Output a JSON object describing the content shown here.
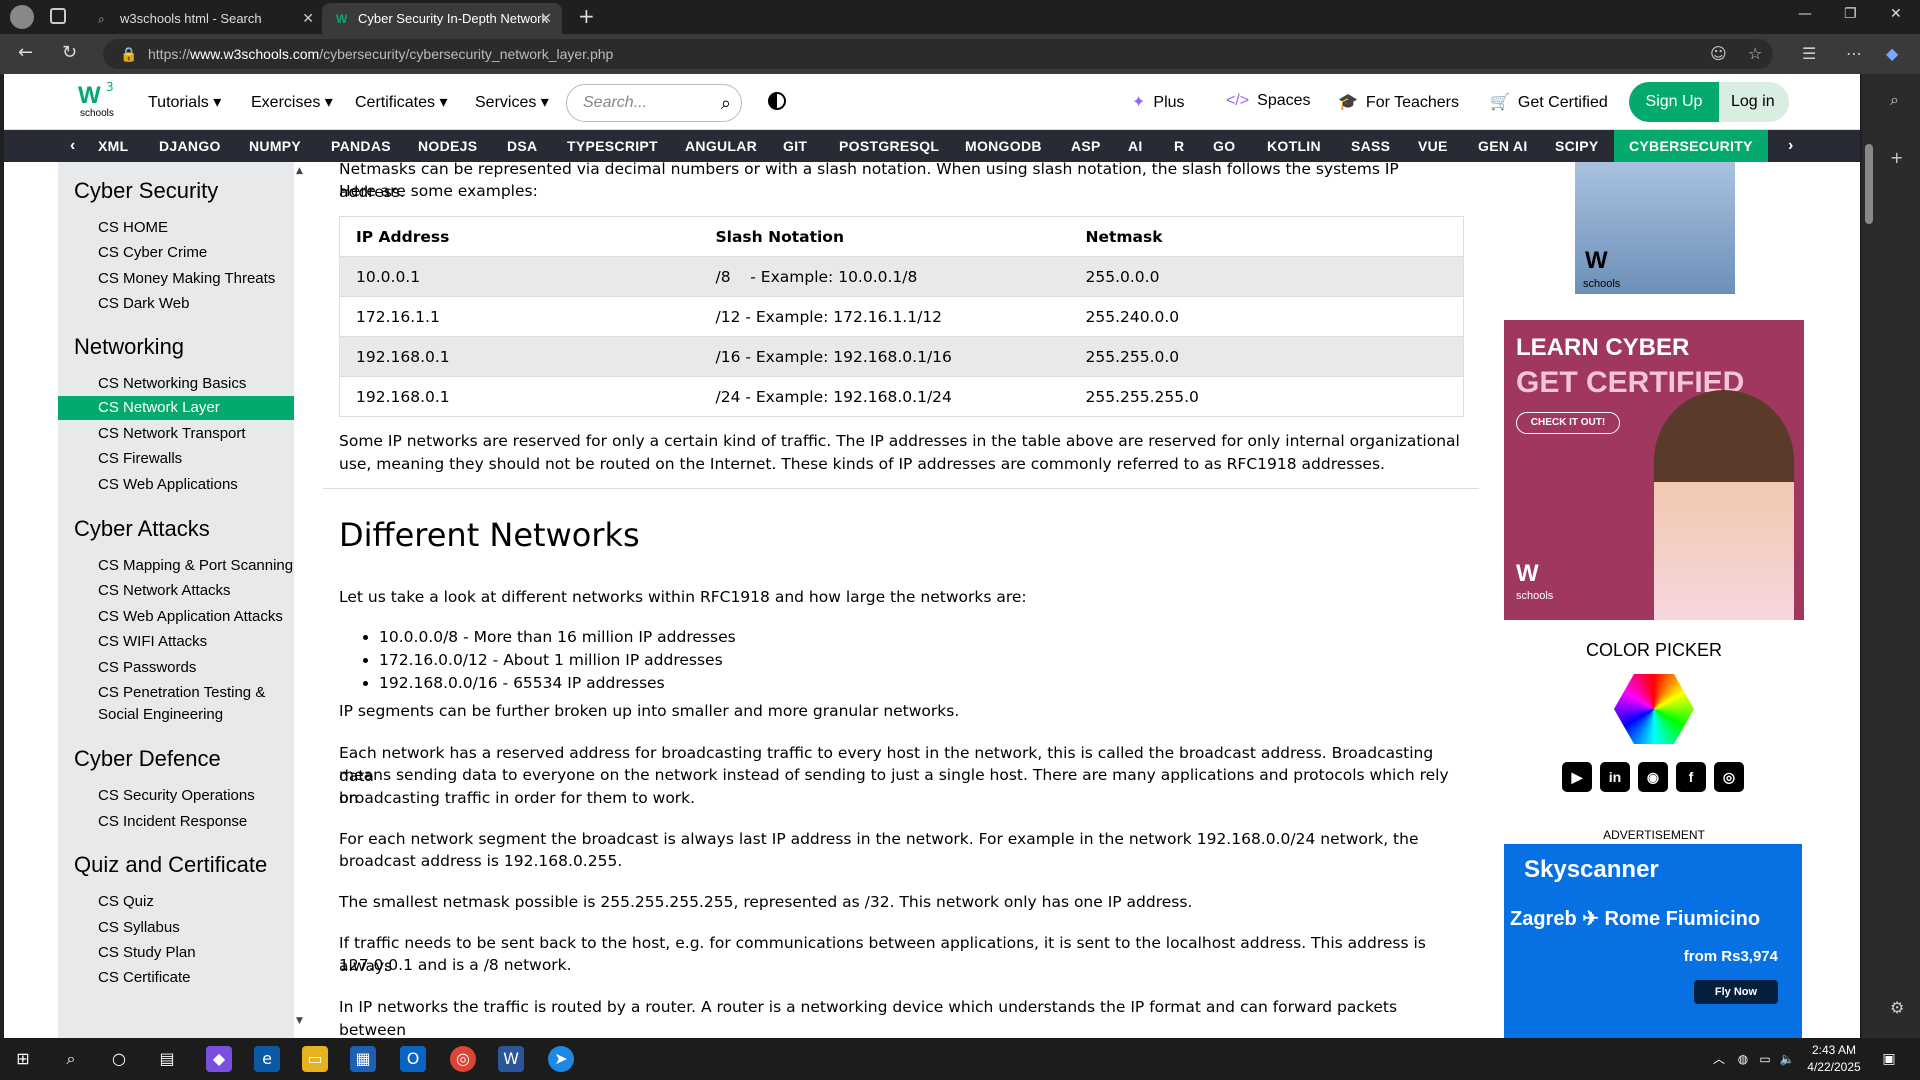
{
  "browser": {
    "tabs": [
      {
        "title": "w3schools html - Search"
      },
      {
        "title": "Cyber Security In-Depth Network"
      }
    ],
    "url_host": "www.w3schools.com",
    "url_path": "/cybersecurity/cybersecurity_network_layer.php",
    "url_scheme": "https://"
  },
  "topnav": {
    "logo_sup": "3",
    "logo_text": "schools",
    "menu": [
      "Tutorials",
      "Exercises",
      "Certificates",
      "Services"
    ],
    "search_placeholder": "Search...",
    "links": [
      "Plus",
      "Spaces",
      "For Teachers",
      "Get Certified"
    ],
    "signup": "Sign Up",
    "login": "Log in"
  },
  "subnav": {
    "items": [
      "XML",
      "DJANGO",
      "NUMPY",
      "PANDAS",
      "NODEJS",
      "DSA",
      "TYPESCRIPT",
      "ANGULAR",
      "GIT",
      "POSTGRESQL",
      "MONGODB",
      "ASP",
      "AI",
      "R",
      "GO",
      "KOTLIN",
      "SASS",
      "VUE",
      "GEN AI",
      "SCIPY",
      "CYBERSECURITY"
    ]
  },
  "sidebar": {
    "sections": [
      {
        "title": "Cyber Security",
        "items": [
          "CS HOME",
          "CS Cyber Crime",
          "CS Money Making Threats",
          "CS Dark Web"
        ]
      },
      {
        "title": "Networking",
        "items": [
          "CS Networking Basics",
          "CS Network Layer",
          "CS Network Transport",
          "CS Firewalls",
          "CS Web Applications"
        ]
      },
      {
        "title": "Cyber Attacks",
        "items": [
          "CS Mapping & Port Scanning",
          "CS Network Attacks",
          "CS Web Application Attacks",
          "CS WIFI Attacks",
          "CS Passwords",
          "CS Penetration Testing &",
          "Social Engineering"
        ]
      },
      {
        "title": "Cyber Defence",
        "items": [
          "CS Security Operations",
          "CS Incident Response"
        ]
      },
      {
        "title": "Quiz and Certificate",
        "items": [
          "CS Quiz",
          "CS Syllabus",
          "CS Study Plan",
          "CS Certificate"
        ]
      }
    ],
    "active": "CS Network Layer"
  },
  "main": {
    "intro_line1": "Netmasks can be represented via decimal numbers or with a slash notation.  When using slash notation, the slash follows the systems IP address.",
    "intro_line2": "Here are some examples:",
    "table": {
      "headers": [
        "IP Address",
        "Slash Notation",
        "Netmask"
      ],
      "rows": [
        [
          "10.0.0.1",
          "/8    - Example: 10.0.0.1/8",
          "255.0.0.0"
        ],
        [
          "172.16.1.1",
          "/12 - Example: 172.16.1.1/12",
          "255.240.0.0"
        ],
        [
          "192.168.0.1",
          "/16 - Example: 192.168.0.1/16",
          "255.255.0.0"
        ],
        [
          "192.168.0.1",
          "/24 - Example: 192.168.0.1/24",
          "255.255.255.0"
        ]
      ]
    },
    "p_reserved_1": "Some IP networks are reserved for only a certain kind of traffic. The IP addresses in the table above are reserved for only internal organizational",
    "p_reserved_2": "use, meaning they should not be routed on the Internet. These kinds of IP addresses are commonly referred to as RFC1918 addresses.",
    "h2": "Different Networks",
    "p_look": "Let us take a look at different networks within RFC1918 and how large the networks are:",
    "list": [
      "10.0.0.0/8 - More than 16 million IP addresses",
      "172.16.0.0/12 - About 1 million IP addresses",
      "192.168.0.0/16 - 65534 IP addresses"
    ],
    "p_segments": "IP segments can be further broken up into smaller and more granular networks.",
    "p_broadcast_1": "Each network has a reserved address for broadcasting traffic to every host in the network, this is called the broadcast address. Broadcasting data",
    "p_broadcast_2": "means sending data to everyone on the network instead of sending to just a single host. There are many applications and protocols which rely on",
    "p_broadcast_3": "broadcasting traffic in order for them to work.",
    "p_segment_1": "For each network segment the broadcast is always last IP address in the network. For example in the network 192.168.0.0/24 network, the",
    "p_segment_2": "broadcast address is 192.168.0.255.",
    "p_smallest": "The smallest netmask possible is 255.255.255.255, represented as /32. This network only has one IP address.",
    "p_localhost_1": "If traffic needs to be sent back to the host, e.g. for communications between applications, it is sent to the localhost address. This address is always",
    "p_localhost_2": "127.0.0.1 and is a /8 network.",
    "p_router": "In IP networks the traffic is routed by a router. A router is a networking device which understands the IP format and can forward packets between"
  },
  "right": {
    "ad2_line1": "LEARN CYBER",
    "ad2_line2": "GET CERTIFIED",
    "ad2_btn": "CHECK IT OUT!",
    "color_picker": "COLOR PICKER",
    "advertisement": "ADVERTISEMENT",
    "sky_brand": "Skyscanner",
    "sky_route": "Zagreb ✈ Rome Fiumicino",
    "sky_price": "from Rs3,974",
    "sky_btn": "Fly Now"
  },
  "taskbar": {
    "time": "2:43 AM",
    "date": "4/22/2025"
  }
}
